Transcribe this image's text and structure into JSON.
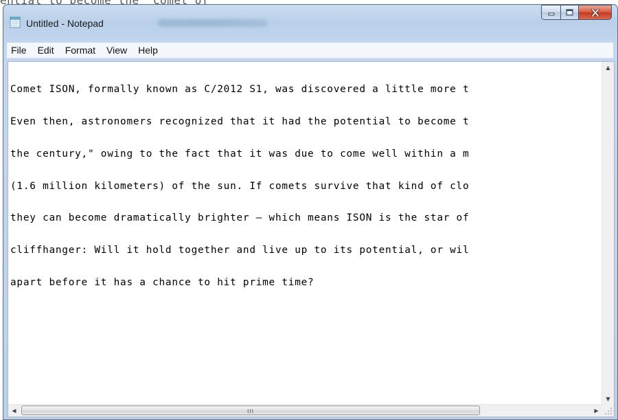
{
  "background": {
    "text": "ential to become the  comet of"
  },
  "window": {
    "title": "Untitled - Notepad",
    "controls": {
      "minimize": "minimize",
      "maximize": "maximize",
      "close": "close"
    }
  },
  "menu": [
    "File",
    "Edit",
    "Format",
    "View",
    "Help"
  ],
  "editor": {
    "lines": [
      "Comet ISON, formally known as C/2012 S1, was discovered a little more t",
      "Even then, astronomers recognized that it had the potential to become t",
      "the century,\" owing to the fact that it was due to come well within a m",
      "(1.6 million kilometers) of the sun. If comets survive that kind of clo",
      "they can become dramatically brighter — which means ISON is the star of",
      "cliffhanger: Will it hold together and live up to its potential, or wil",
      "apart before it has a chance to hit prime time?"
    ]
  },
  "scrollbar": {
    "thumb_grip": "III"
  },
  "colors": {
    "close_button": "#c43a1e",
    "frame": "#b9d0ea",
    "menubar": "#f4f7fc"
  }
}
